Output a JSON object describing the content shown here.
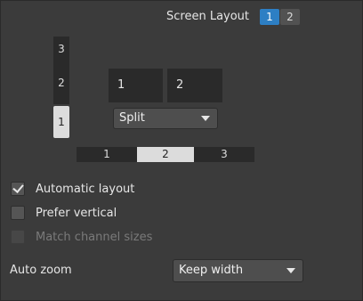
{
  "screen_layout": {
    "label": "Screen Layout",
    "options": [
      "1",
      "2"
    ],
    "selected": "1"
  },
  "vertical_selector": {
    "options": [
      "3",
      "2",
      "1"
    ],
    "selected": "1"
  },
  "layout_cells": [
    "1",
    "2"
  ],
  "split_dropdown": {
    "value": "Split"
  },
  "horizontal_selector": {
    "options": [
      "1",
      "2",
      "3"
    ],
    "selected": "2"
  },
  "checkboxes": [
    {
      "label": "Automatic layout",
      "checked": true,
      "enabled": true
    },
    {
      "label": "Prefer vertical",
      "checked": false,
      "enabled": true
    },
    {
      "label": "Match channel sizes",
      "checked": false,
      "enabled": false
    }
  ],
  "auto_zoom": {
    "label": "Auto zoom",
    "value": "Keep width"
  },
  "icons": {
    "check": "check-icon",
    "dropdown_arrow": "chevron-down-icon"
  },
  "colors": {
    "accent": "#2d7fc4",
    "background": "#3b3b3b",
    "cell": "#2a2a2a",
    "selected": "#dcdcdc"
  }
}
